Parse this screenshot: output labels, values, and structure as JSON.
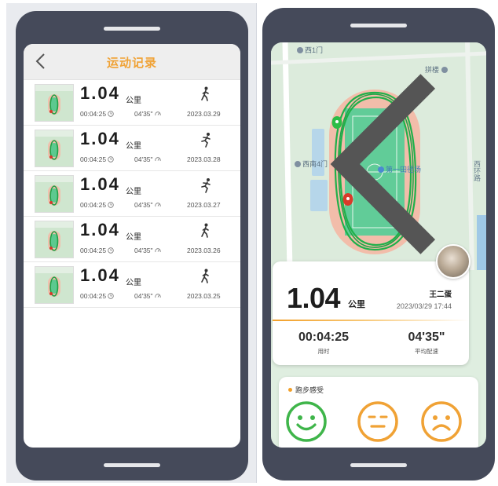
{
  "list_screen": {
    "title": "运动记录",
    "unit": "公里",
    "records": [
      {
        "distance": "1.04",
        "duration": "00:04:25",
        "pace": "04'35\"",
        "date": "2023.03.29",
        "mode": "walk-icon"
      },
      {
        "distance": "1.04",
        "duration": "00:04:25",
        "pace": "04'35\"",
        "date": "2023.03.28",
        "mode": "run-icon"
      },
      {
        "distance": "1.04",
        "duration": "00:04:25",
        "pace": "04'35\"",
        "date": "2023.03.27",
        "mode": "run-icon"
      },
      {
        "distance": "1.04",
        "duration": "00:04:25",
        "pace": "04'35\"",
        "date": "2023.03.26",
        "mode": "walk-icon"
      },
      {
        "distance": "1.04",
        "duration": "00:04:25",
        "pace": "04'35\"",
        "date": "2023.03.25",
        "mode": "walk-icon"
      }
    ]
  },
  "detail_screen": {
    "map": {
      "poi_top_left": "西1门",
      "poi_top_right": "拼楼",
      "poi_left": "西南4门",
      "poi_center": "第一田径场",
      "poi_vertical": "西环路"
    },
    "summary": {
      "distance": "1.04",
      "unit": "公里",
      "user_name": "王二蛋",
      "datetime": "2023/03/29 17:44",
      "duration_value": "00:04:25",
      "duration_label": "用时",
      "pace_value": "04'35\"",
      "pace_label": "平均配速"
    },
    "feeling": {
      "title": "跑步感受",
      "options": [
        "happy-face-icon",
        "neutral-face-icon",
        "sad-face-icon"
      ]
    }
  },
  "colors": {
    "accent": "#f0a235",
    "frame": "#454a5a",
    "happy": "#3fb54a",
    "neutral": "#f0a235",
    "sad": "#f0a235",
    "track": "#f3c0ad",
    "field": "#63cf9a",
    "route": "#22b24c"
  }
}
